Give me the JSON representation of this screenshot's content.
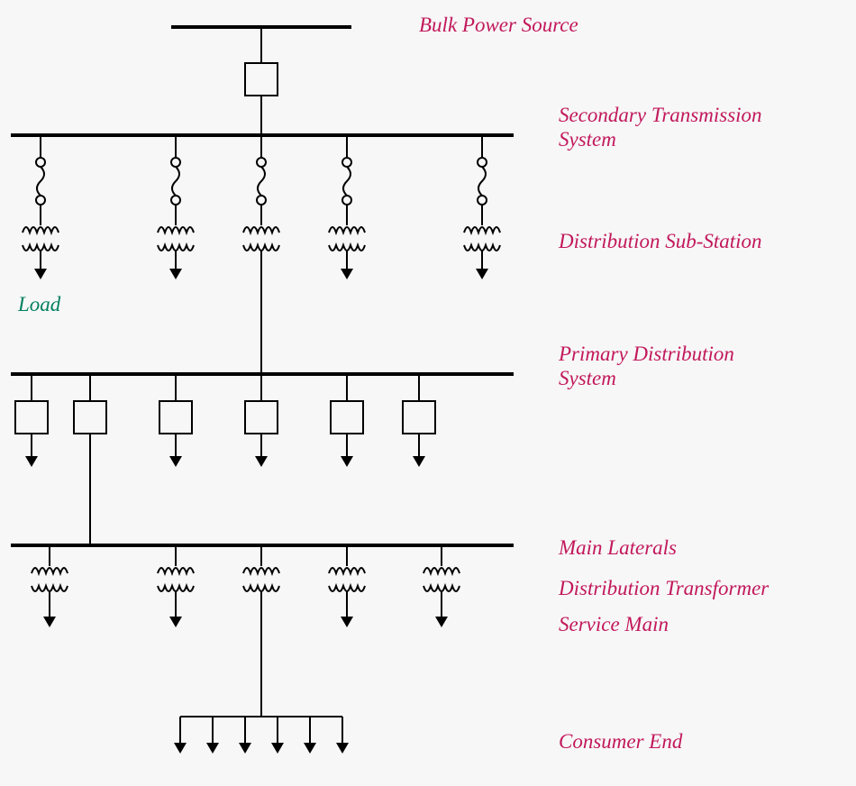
{
  "labels": {
    "bulk": "Bulk Power Source",
    "secondary1": "Secondary Transmission",
    "secondary2": "System",
    "substation": "Distribution Sub-Station",
    "load": "Load",
    "primary1": "Primary Distribution",
    "primary2": "System",
    "laterals": "Main Laterals",
    "dtransformer": "Distribution Transformer",
    "service": "Service Main",
    "consumer": "Consumer End"
  },
  "colors": {
    "stroke": "#000000",
    "label": "#C2185B",
    "load": "#008060",
    "bg": "#f7f7f7"
  }
}
